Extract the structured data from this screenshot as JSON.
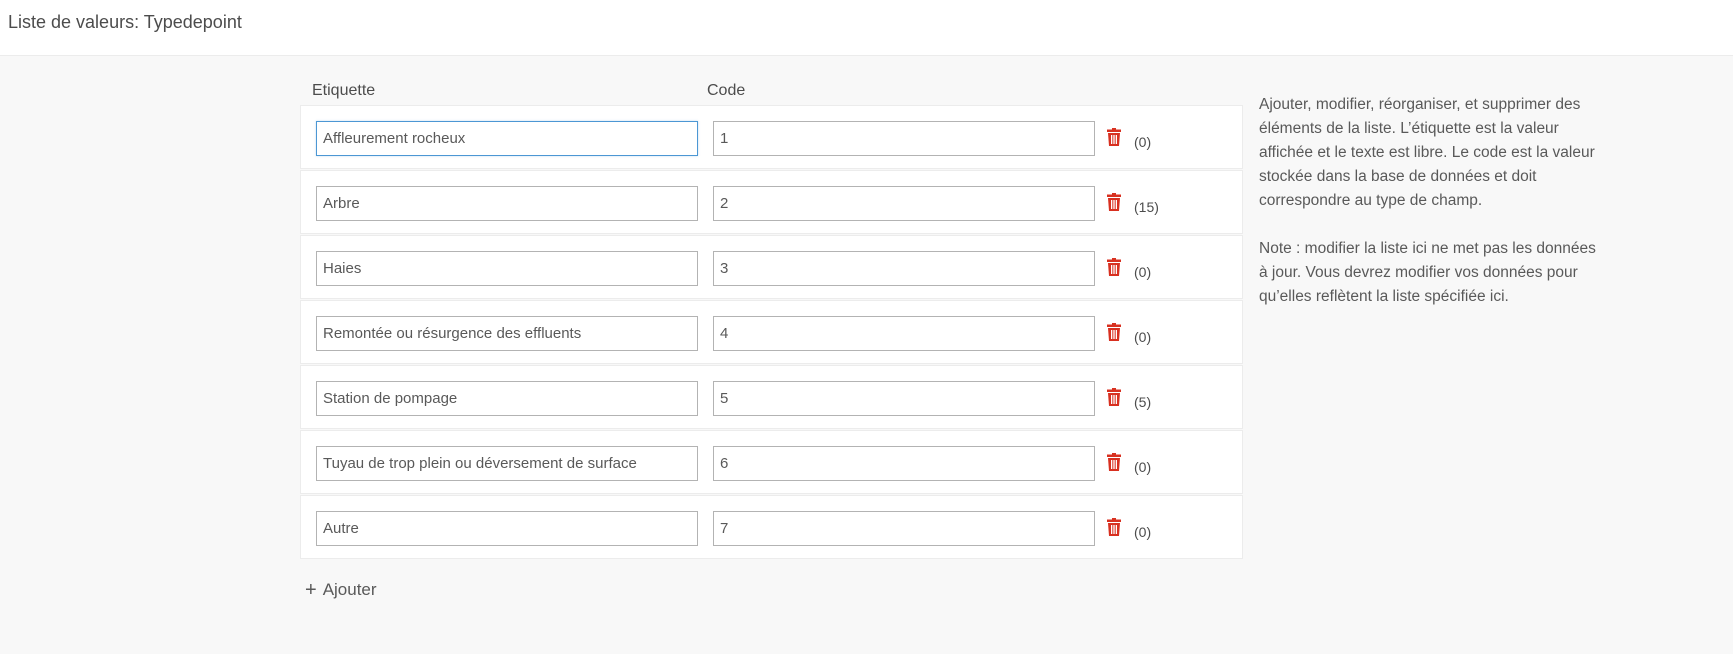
{
  "header": {
    "title": "Liste de valeurs: Typedepoint"
  },
  "columns": {
    "label": "Etiquette",
    "code": "Code"
  },
  "rows": [
    {
      "label": "Affleurement rocheux",
      "code": "1",
      "count": "(0)"
    },
    {
      "label": "Arbre",
      "code": "2",
      "count": "(15)"
    },
    {
      "label": "Haies",
      "code": "3",
      "count": "(0)"
    },
    {
      "label": "Remontée ou résurgence des effluents",
      "code": "4",
      "count": "(0)"
    },
    {
      "label": "Station de pompage",
      "code": "5",
      "count": "(5)"
    },
    {
      "label": "Tuyau de trop plein ou déversement de surface",
      "code": "6",
      "count": "(0)"
    },
    {
      "label": "Autre",
      "code": "7",
      "count": "(0)"
    }
  ],
  "add_button": {
    "icon": "plus-icon",
    "label": "Ajouter"
  },
  "help": {
    "paragraph1": "Ajouter, modifier, réorganiser, et supprimer des éléments de la liste. L’étiquette est la valeur affichée et le texte est libre. Le code est la valeur stockée dans la base de données et doit correspondre au type de champ.",
    "paragraph2": "Note : modifier la liste ici ne met pas les données à jour. Vous devrez modifier vos données pour qu’elles reflètent la liste spécifiée ici."
  },
  "colors": {
    "delete_icon": "#d83020",
    "focus_border": "#4c97d4"
  }
}
